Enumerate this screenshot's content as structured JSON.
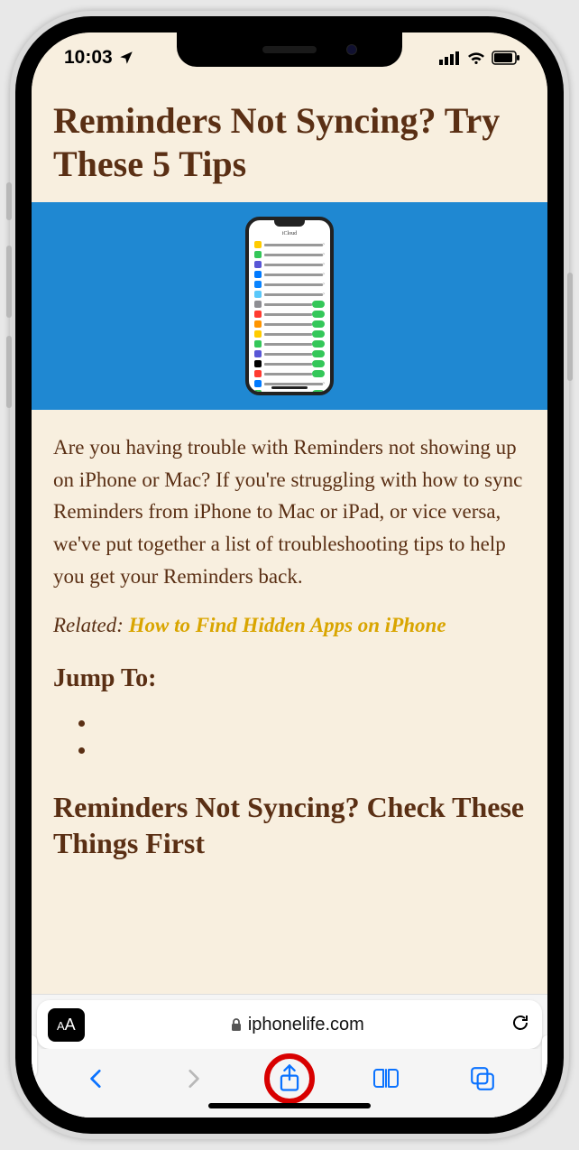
{
  "status": {
    "time": "10:03",
    "location_icon": "location-arrow"
  },
  "article": {
    "title": "Reminders Not Syncing? Try These 5 Tips",
    "hero_alt": "iCloud settings on iPhone",
    "intro": "Are you having trouble with Reminders not showing up on iPhone or Mac? If you're struggling with how to sync Reminders from iPhone to Mac or iPad, or vice versa, we've put together a list of troubleshooting tips to help you get your Reminders back.",
    "related_label": "Related:",
    "related_link_text": "How to Find Hidden Apps on iPhone",
    "jump_to_heading": "Jump To:",
    "jump_items": [
      "",
      ""
    ],
    "section_heading": "Reminders Not Syncing? Check These Things First"
  },
  "address_bar": {
    "reader_label": "AA",
    "domain": "iphonelife.com"
  },
  "toolbar": {
    "back": "Back",
    "forward": "Forward",
    "share": "Share",
    "bookmarks": "Bookmarks",
    "tabs": "Tabs"
  },
  "annotation": {
    "highlight": "share-button"
  }
}
